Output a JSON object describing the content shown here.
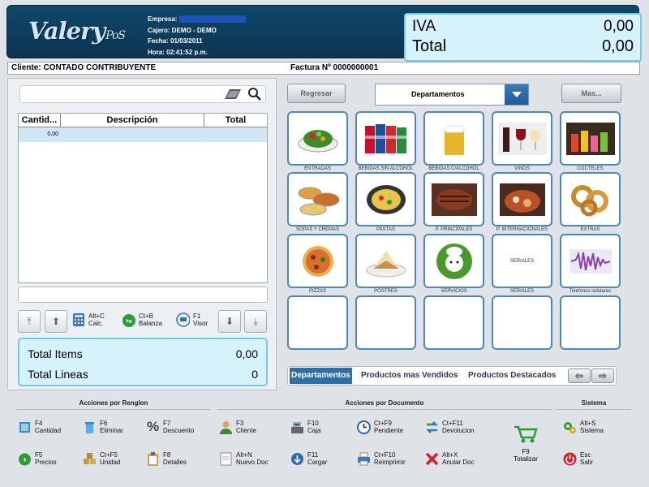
{
  "header": {
    "logo_main": "Valery",
    "logo_sub": "PoS",
    "empresa_label": "Empresa:",
    "cajero_label": "Cajero:",
    "cajero_value": "DEMO  - DEMO",
    "fecha_label": "Fecha:",
    "fecha_value": "01/03/2011",
    "hora_label": "Hora:",
    "hora_value": "02:41:52 p.m.",
    "iva_label": "IVA",
    "iva_value": "0,00",
    "total_label": "Total",
    "total_value": "0,00"
  },
  "client_bar": {
    "cliente": "Cliente: CONTADO CONTRIBUYENTE",
    "factura": "Factura Nº 0000000001"
  },
  "grid": {
    "columns": [
      "Cantid...",
      "Descripción",
      "Total"
    ],
    "rows": [
      {
        "cantidad": "0,00",
        "descripcion": "",
        "total": ""
      }
    ]
  },
  "small_buttons": [
    {
      "key": "Alt+C",
      "label": "Calc."
    },
    {
      "key": "Ct+B",
      "label": "Balanza"
    },
    {
      "key": "F1",
      "label": "Visor"
    }
  ],
  "summary": {
    "items_label": "Total Items",
    "items_value": "0,00",
    "lineas_label": "Total Lineas",
    "lineas_value": "0"
  },
  "nav": {
    "regresar": "Regresar",
    "departamentos": "Departamentos",
    "mas": "Mas..."
  },
  "tiles": [
    {
      "label": "ENTRADAS",
      "icon": "salad-icon"
    },
    {
      "label": "BEBIDAS SIN ALCOHOL",
      "icon": "soda-cans-icon"
    },
    {
      "label": "BEBIDAS C/ALCOHOL",
      "icon": "beer-glass-icon"
    },
    {
      "label": "VINOS",
      "icon": "wine-icon"
    },
    {
      "label": "COCTELES",
      "icon": "cocktails-icon"
    },
    {
      "label": "SOPAS Y CREMAS",
      "icon": "soup-icon"
    },
    {
      "label": "PASTAS",
      "icon": "pasta-icon"
    },
    {
      "label": "P. PRINCIPALES",
      "icon": "steak-icon"
    },
    {
      "label": "P. INTERNACIONALES",
      "icon": "international-dish-icon"
    },
    {
      "label": "EXTRAS",
      "icon": "onion-rings-icon"
    },
    {
      "label": "PIZZAS",
      "icon": "pizza-icon"
    },
    {
      "label": "POSTRES",
      "icon": "dessert-icon"
    },
    {
      "label": "SERVICIOS",
      "icon": "chef-icon"
    },
    {
      "label": "SERIALES",
      "icon": "seriales-text",
      "inner": "SERIALES"
    },
    {
      "label": "Telefonos celulares",
      "icon": "waveform-icon"
    }
  ],
  "tabs": [
    "Departamentos",
    "Productos mas Vendidos",
    "Productos Destacados"
  ],
  "sections": {
    "renglon": "Acciones por Renglon",
    "documento": "Acciones por Documento",
    "sistema": "Sistema"
  },
  "actions": [
    {
      "key": "F4",
      "label": "Cantidad",
      "icon": "quantity-icon"
    },
    {
      "key": "F6",
      "label": "Eliminar",
      "icon": "trash-icon"
    },
    {
      "key": "F7",
      "label": "Descuento",
      "icon": "percent-icon"
    },
    {
      "key": "F3",
      "label": "Cliente",
      "icon": "person-icon"
    },
    {
      "key": "F10",
      "label": "Caja",
      "icon": "cash-register-icon"
    },
    {
      "key": "Ct+F9",
      "label": "Pendiente",
      "icon": "clock-icon"
    },
    {
      "key": "Ct+F11",
      "label": "Devolucion",
      "icon": "return-arrows-icon"
    },
    {
      "key": "Alt+S",
      "label": "Sistema",
      "icon": "gears-icon"
    },
    {
      "key": "F5",
      "label": "Precios",
      "icon": "price-tag-icon"
    },
    {
      "key": "Ct+F5",
      "label": "Unidad",
      "icon": "boxes-icon"
    },
    {
      "key": "F8",
      "label": "Detalles",
      "icon": "clipboard-icon"
    },
    {
      "key": "Alt+N",
      "label": "Nuevo Doc",
      "icon": "new-doc-icon"
    },
    {
      "key": "F11",
      "label": "Cargar",
      "icon": "load-icon"
    },
    {
      "key": "Ct+F10",
      "label": "Reimprimir",
      "icon": "printer-icon"
    },
    {
      "key": "Alt+X",
      "label": "Anular Doc",
      "icon": "cancel-x-icon"
    },
    {
      "key": "Esc",
      "label": "Salir",
      "icon": "power-icon"
    },
    {
      "key": "F9",
      "label": "Totalizar",
      "icon": "cart-icon"
    }
  ],
  "colors": {
    "header_bg": "#0f4468",
    "accent_light": "#d6f3fb",
    "accent_border": "#7ac8e0",
    "tile_border": "#4e88b5",
    "grid_row": "#cfe7f5"
  }
}
